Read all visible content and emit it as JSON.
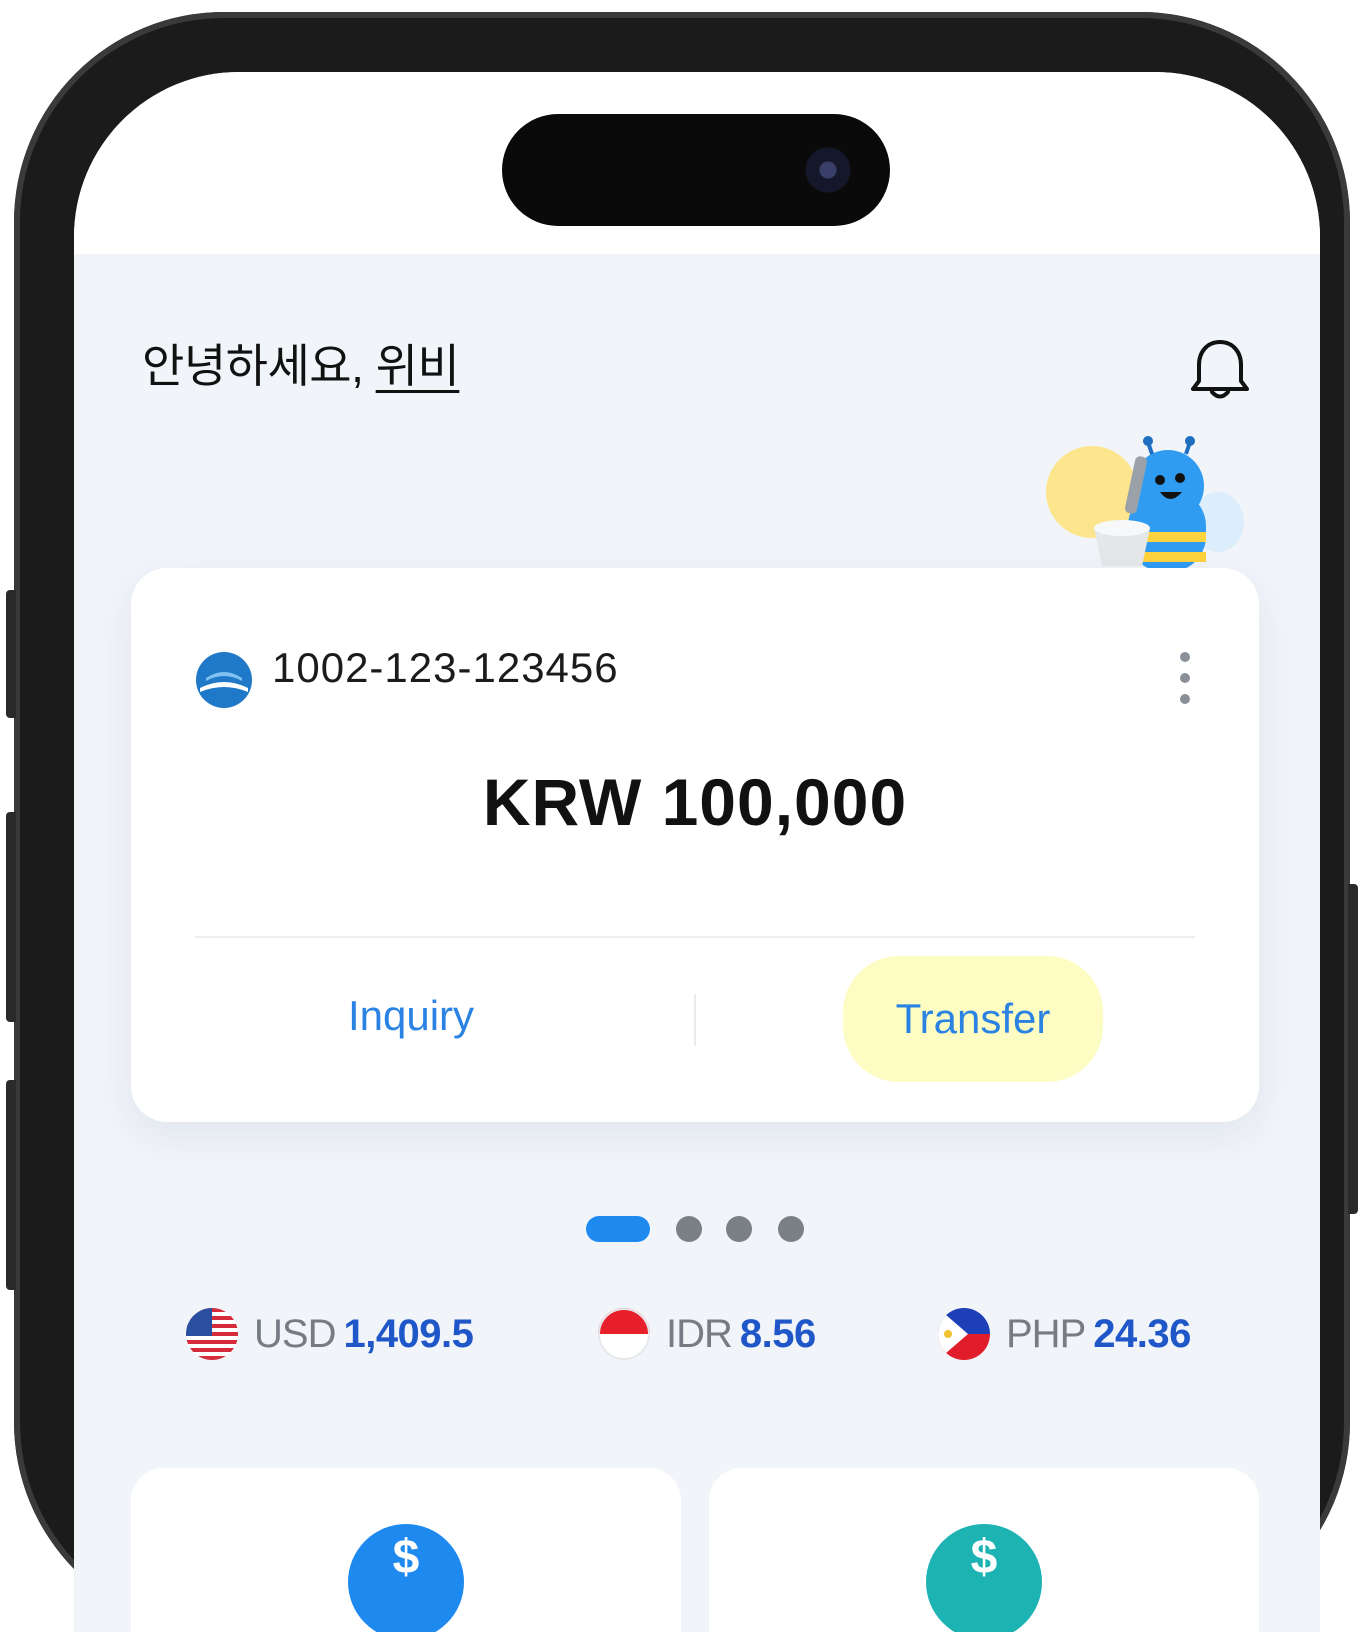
{
  "greeting": {
    "prefix": "안녕하세요, ",
    "name": "위비"
  },
  "account": {
    "number": "1002-123-123456",
    "balance": "KRW 100,000",
    "actions": {
      "inquiry": "Inquiry",
      "transfer": "Transfer"
    }
  },
  "carousel": {
    "page_count": 4,
    "active_index": 0
  },
  "rates": [
    {
      "currency": "USD",
      "value": "1,409.5",
      "flag": "us-flag"
    },
    {
      "currency": "IDR",
      "value": "8.56",
      "flag": "id-flag"
    },
    {
      "currency": "PHP",
      "value": "24.36",
      "flag": "ph-flag"
    }
  ],
  "tiles": [
    {
      "icon": "dollar-icon",
      "symbol": "$",
      "color": "#1e8af0"
    },
    {
      "icon": "dollar-icon",
      "symbol": "$",
      "color": "#1db3b3"
    }
  ],
  "colors": {
    "accent": "#2a83e2",
    "transfer_bg": "#fdfcc2",
    "rate_value": "#1f57c8"
  }
}
